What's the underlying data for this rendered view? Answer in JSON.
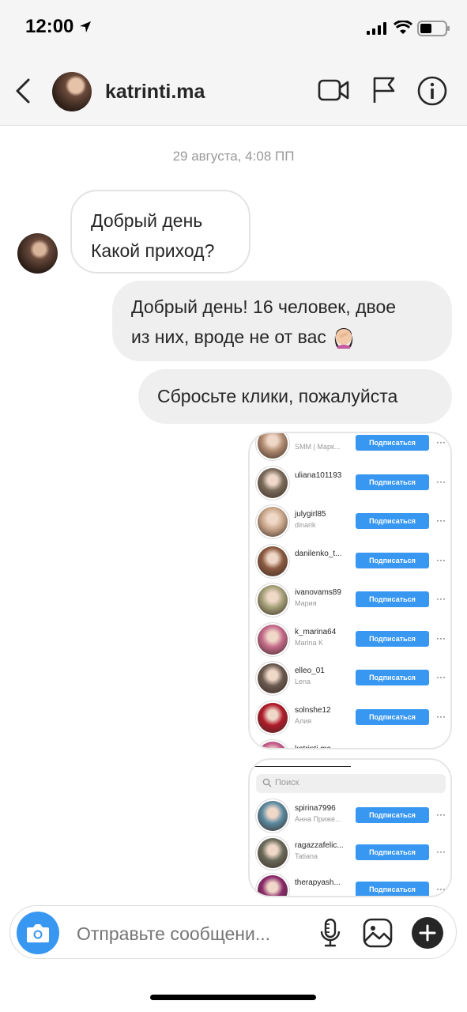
{
  "status_bar": {
    "time": "12:00"
  },
  "header": {
    "username": "katrinti.ma"
  },
  "thread": {
    "timestamp": "29 августа, 4:08 ПП",
    "incoming": {
      "line1": "Добрый день",
      "line2": "Какой приход?"
    },
    "outgoing1": {
      "line1": "Добрый день! 16 человек, двое",
      "line2": "из них, вроде не от вас"
    },
    "outgoing2": {
      "text": "Сбросьте клики, пожалуйста"
    }
  },
  "shot1": {
    "rows": [
      {
        "name": "",
        "sub": "SMM | Марк...",
        "button": "Подписаться",
        "avatar_color": "#b08a70"
      },
      {
        "name": "uliana101193",
        "sub": "",
        "button": "Подписаться",
        "avatar_color": "#7a6a5a"
      },
      {
        "name": "julygirl85",
        "sub": "dinarik",
        "button": "Подписаться",
        "avatar_color": "#c9a68a"
      },
      {
        "name": "danilenko_t...",
        "sub": "",
        "button": "Подписаться",
        "avatar_color": "#8a5a40"
      },
      {
        "name": "ivanovams89",
        "sub": "Мария",
        "button": "Подписаться",
        "avatar_color": "#a4a078"
      },
      {
        "name": "k_marina64",
        "sub": "Marina K",
        "button": "Подписаться",
        "avatar_color": "#c46a8a"
      },
      {
        "name": "elleo_01",
        "sub": "Lena",
        "button": "Подписаться",
        "avatar_color": "#6a5a50"
      },
      {
        "name": "solnshe12",
        "sub": "Алия",
        "button": "Подписаться",
        "avatar_color": "#b01a2a"
      },
      {
        "name": "katrinti.ma",
        "sub": "",
        "button": "",
        "avatar_color": "#c45a8a"
      }
    ]
  },
  "shot2": {
    "search_placeholder": "Поиск",
    "rows": [
      {
        "name": "spirina7996",
        "sub": "Анна Прижe...",
        "button": "Подписаться",
        "avatar_color": "#5a8aa0"
      },
      {
        "name": "ragazzafelic...",
        "sub": "Tatiana",
        "button": "Подписаться",
        "avatar_color": "#6a6a5a"
      },
      {
        "name": "therapyash...",
        "sub": "",
        "button": "Подписаться",
        "avatar_color": "#8a2a6a"
      }
    ]
  },
  "composer": {
    "placeholder": "Отправьте сообщени..."
  },
  "colors": {
    "accent": "#3897f0",
    "bubble_out": "#efefef",
    "text": "#262626"
  }
}
